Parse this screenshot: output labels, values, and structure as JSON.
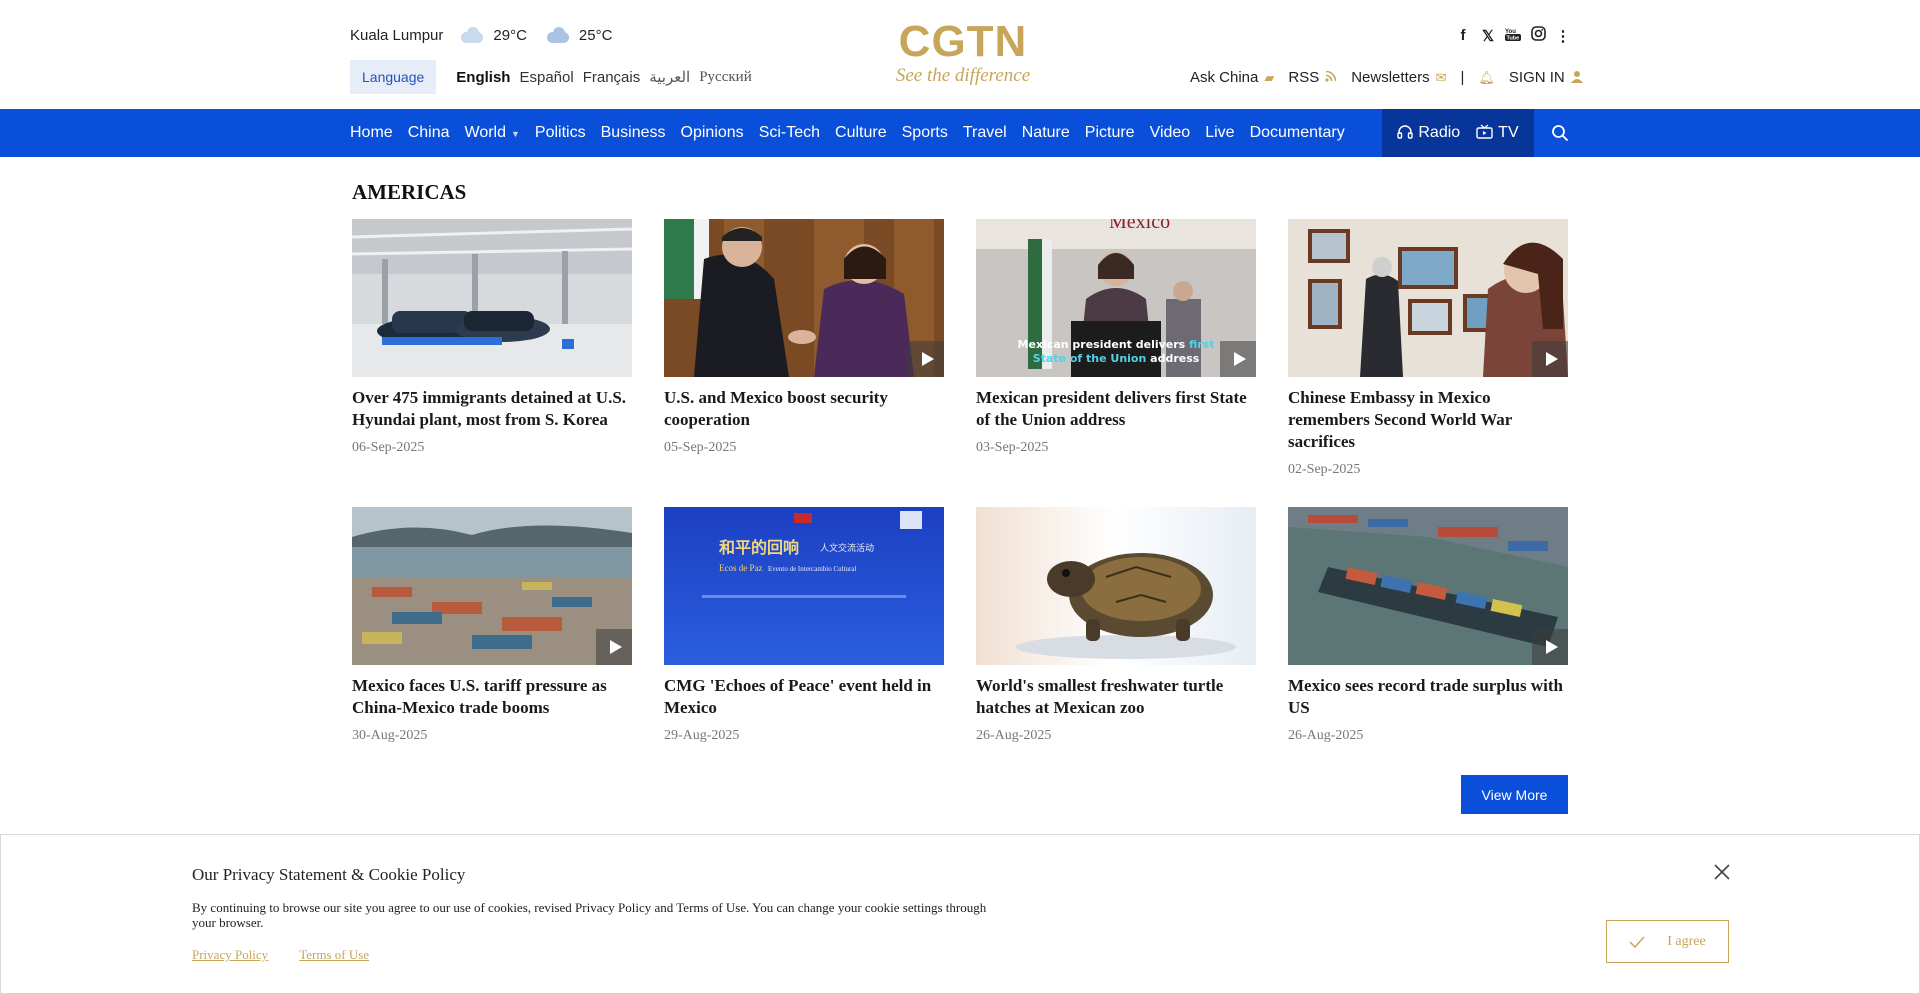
{
  "header": {
    "city": "Kuala Lumpur",
    "weather": [
      {
        "icon": "cloudy-icon",
        "temp": "29°C"
      },
      {
        "icon": "rain-icon",
        "temp": "25°C"
      }
    ],
    "language_button": "Language",
    "languages": [
      "English",
      "Español",
      "Français",
      "العربية",
      "Русский"
    ],
    "logo_mark": "CGTN",
    "logo_tagline": "See the difference",
    "ask_china": "Ask China",
    "rss": "RSS",
    "newsletters": "Newsletters",
    "separator": "|",
    "sign_in": "SIGN IN",
    "social_icons": [
      "facebook-icon",
      "x-icon",
      "youtube-icon",
      "instagram-icon",
      "more-icon"
    ]
  },
  "nav": {
    "items": [
      "Home",
      "China",
      "World",
      "Politics",
      "Business",
      "Opinions",
      "Sci-Tech",
      "Culture",
      "Sports",
      "Travel",
      "Nature",
      "Picture",
      "Video",
      "Live",
      "Documentary"
    ],
    "radio": "Radio",
    "tv": "TV"
  },
  "section": {
    "title": "AMERICAS",
    "articles": [
      {
        "headline": "Over 475 immigrants detained at U.S. Hyundai plant, most from S. Korea",
        "date": "06-Sep-2025",
        "video": false
      },
      {
        "headline": "U.S. and Mexico boost security cooperation",
        "date": "05-Sep-2025",
        "video": true
      },
      {
        "headline": "Mexican president delivers first State of the Union address",
        "date": "03-Sep-2025",
        "video": true,
        "overlay_a": "Mexican president delivers ",
        "overlay_b": "first",
        "overlay_c": "State of the Union",
        "overlay_d": " address",
        "overlay_top": "Mexico"
      },
      {
        "headline": "Chinese Embassy in Mexico remembers Second World War sacrifices",
        "date": "02-Sep-2025",
        "video": true
      },
      {
        "headline": "Mexico faces U.S. tariff pressure as China-Mexico trade booms",
        "date": "30-Aug-2025",
        "video": true
      },
      {
        "headline": "CMG 'Echoes of Peace' event held in Mexico",
        "date": "29-Aug-2025",
        "video": false,
        "poster_title": "和平的回响",
        "poster_sub": "人文交流活动",
        "poster_es": "Ecos de Paz",
        "poster_es2": "Evento de Intercambio Cultural"
      },
      {
        "headline": "World's smallest freshwater turtle hatches at Mexican zoo",
        "date": "26-Aug-2025",
        "video": false
      },
      {
        "headline": "Mexico sees record trade surplus with US",
        "date": "26-Aug-2025",
        "video": true
      }
    ],
    "view_more": "View More"
  },
  "cookie": {
    "title": "Our Privacy Statement & Cookie Policy",
    "text": "By continuing to browse our site you agree to our use of cookies, revised Privacy Policy and Terms of Use. You can change your cookie settings through your browser.",
    "privacy_link": "Privacy Policy",
    "terms_link": "Terms of Use",
    "agree": "I agree"
  },
  "colors": {
    "brand_gold": "#c7a55a",
    "nav_blue": "#0a4fd9",
    "nav_dark": "#07359a"
  }
}
